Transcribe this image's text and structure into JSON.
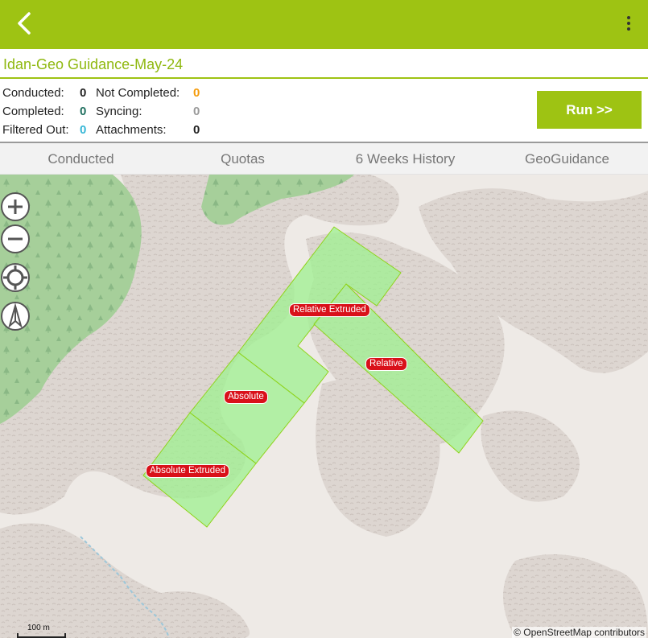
{
  "app": {
    "back_icon": "chevron-left-icon",
    "menu_icon": "more-vertical-icon",
    "accent": "#9ec313"
  },
  "survey_title": "Idan-Geo Guidance-May-24",
  "stats": {
    "conducted_label": "Conducted:",
    "conducted_value": "0",
    "not_completed_label": "Not Completed:",
    "not_completed_value": "0",
    "completed_label": "Completed:",
    "completed_value": "0",
    "syncing_label": "Syncing:",
    "syncing_value": "0",
    "filtered_out_label": "Filtered Out:",
    "filtered_out_value": "0",
    "attachments_label": "Attachments:",
    "attachments_value": "0",
    "colors": {
      "orange": "#f59c0c",
      "teal": "#1f6f5f",
      "cyan": "#35b6d6",
      "gray": "#9a9a9a",
      "black": "#222222"
    }
  },
  "run_button": "Run >>",
  "tabs": [
    {
      "label": "Conducted"
    },
    {
      "label": "Quotas"
    },
    {
      "label": "6 Weeks History"
    },
    {
      "label": "GeoGuidance"
    }
  ],
  "map": {
    "zoom_in_icon": "plus-icon",
    "zoom_out_icon": "minus-icon",
    "locate_icon": "crosshair-icon",
    "compass_icon": "compass-icon",
    "polygons": [
      {
        "label": "Relative Extruded"
      },
      {
        "label": "Relative"
      },
      {
        "label": "Absolute"
      },
      {
        "label": "Absolute Extruded"
      }
    ],
    "scale_label": "100 m",
    "attribution": "© OpenStreetMap contributors"
  }
}
